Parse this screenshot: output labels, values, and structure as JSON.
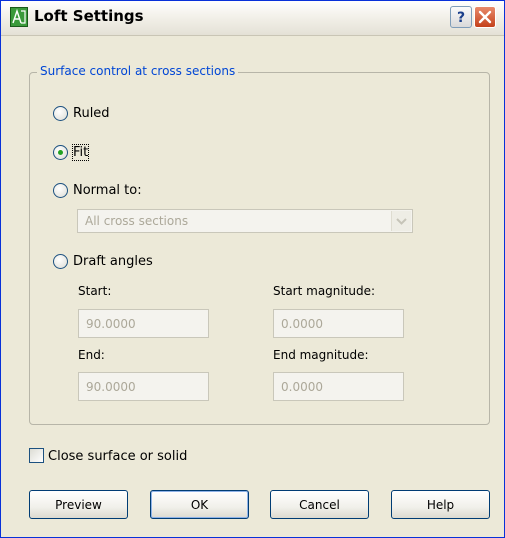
{
  "window": {
    "title": "Loft Settings"
  },
  "group": {
    "legend": "Surface control at cross sections",
    "options": [
      {
        "id": "ruled",
        "label": "Ruled",
        "selected": false
      },
      {
        "id": "fit",
        "label": "Fit",
        "selected": true
      },
      {
        "id": "normal_to",
        "label": "Normal to:",
        "selected": false
      },
      {
        "id": "draft_angles",
        "label": "Draft angles",
        "selected": false
      }
    ],
    "normal_to_combo": {
      "value": "All cross sections",
      "enabled": false
    },
    "draft": {
      "start_label": "Start:",
      "start_value": "90.0000",
      "start_magnitude_label": "Start magnitude:",
      "start_magnitude_value": "0.0000",
      "end_label": "End:",
      "end_value": "90.0000",
      "end_magnitude_label": "End magnitude:",
      "end_magnitude_value": "0.0000"
    }
  },
  "close_surface": {
    "label": "Close surface or solid",
    "checked": false
  },
  "buttons": {
    "preview": "Preview",
    "ok": "OK",
    "cancel": "Cancel",
    "help": "Help"
  },
  "icons": {
    "title_help": "help-icon",
    "title_close": "close-icon",
    "app": "loft-icon"
  },
  "colors": {
    "legend": "#0046d5",
    "selected_dot": "#21a121",
    "disabled_text": "#aca899"
  }
}
